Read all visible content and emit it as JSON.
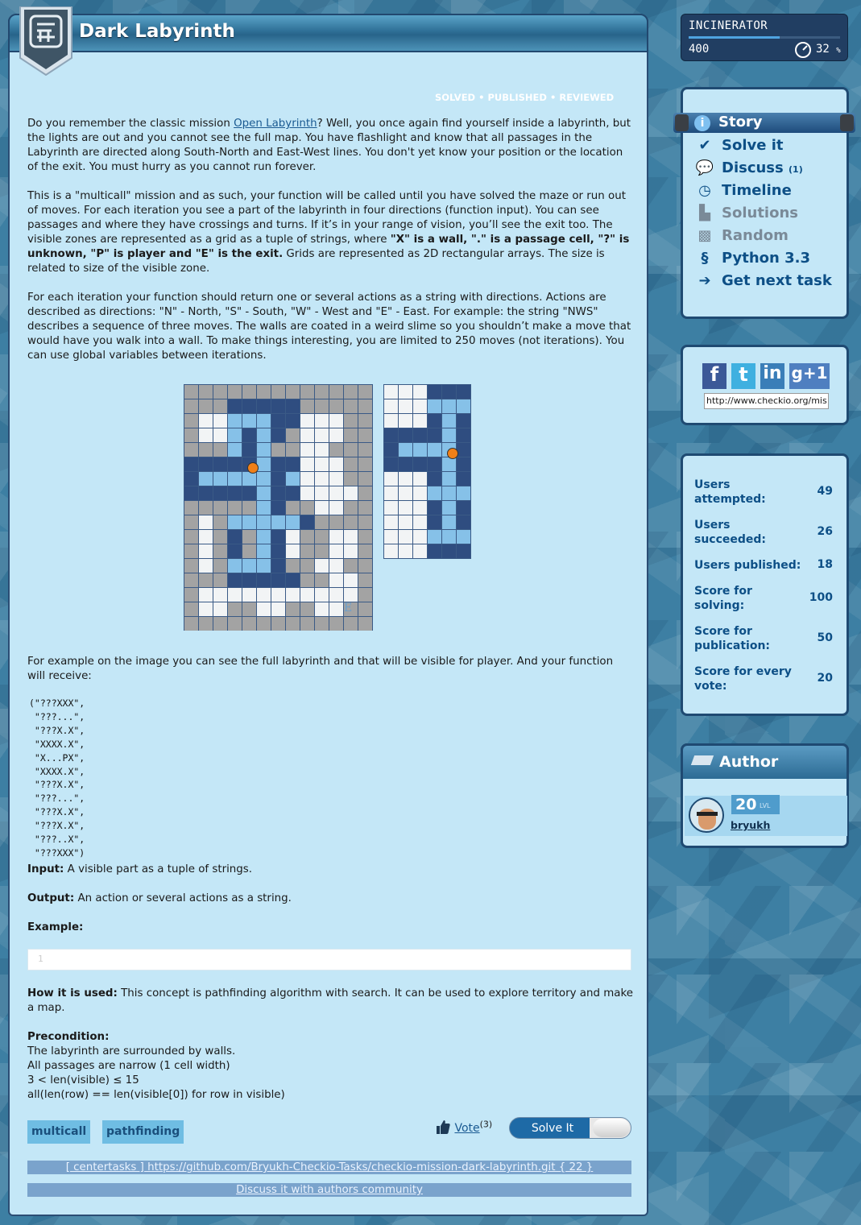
{
  "title": "Dark Labyrinth",
  "status": {
    "solved": "SOLVED",
    "published": "PUBLISHED",
    "reviewed": "REVIEWED",
    "sep": "•"
  },
  "intro": {
    "p1a": "Do you remember the classic mission ",
    "p1link": "Open Labyrinth",
    "p1b": "? Well, you once again find yourself inside a labyrinth, but the lights are out and you cannot see the full map. You have flashlight and know that all passages in the Labyrinth are directed along South-North and East-West lines. You don't yet know your position or the location of the exit. You must hurry as you cannot run forever.",
    "p2a": "This is a \"multicall\" mission and as such, your function will be called until you have solved the maze or run out of moves. For each iteration you see a part of the labyrinth in four directions (function input). You can see passages and where they have crossings and turns. If it’s in your range of vision, you’ll see the exit too. The visible zones are represented as a grid as a tuple of strings, where ",
    "p2b": "\"X\" is a wall, \".\" is a passage cell, \"?\" is unknown, \"P\" is player and \"E\" is the exit.",
    "p2c": " Grids are represented as 2D rectangular arrays. The size is related to size of the visible zone.",
    "p3": "For each iteration your function should return one or several actions as a string with directions. Actions are described as directions: \"N\" - North, \"S\" - South, \"W\" - West and \"E\" - East. For example: the string \"NWS\" describes a sequence of three moves. The walls are coated in a weird slime so you shouldn’t make a move that would have you walk into a wall. To make things interesting, you are limited to 250 moves (not iterations). You can use global variables between iterations.",
    "p4": "For example on the image you can see the full labyrinth and that will be visible for player. And your function will receive:"
  },
  "maze": {
    "exit_label": "E"
  },
  "code_example": "(\"???XXX\",\n \"???...\",\n \"???X.X\",\n \"XXXX.X\",\n \"X...PX\",\n \"XXXX.X\",\n \"???X.X\",\n \"???...\",\n \"???X.X\",\n \"???X.X\",\n \"???..X\",\n \"???XXX\")",
  "io": {
    "input_label": "Input:",
    "input_text": " A visible part as a tuple of strings.",
    "output_label": "Output:",
    "output_text": " An action or several actions as a string.",
    "example_label": "Example:",
    "code_line": "1"
  },
  "how": {
    "label": "How it is used:",
    "text": " This concept is pathfinding algorithm with search. It can be used to explore territory and make a map."
  },
  "pre": {
    "label": "Precondition:",
    "lines": [
      "The labyrinth are surrounded by walls.",
      "All passages are narrow (1 cell width)",
      "3 < len(visible) ≤ 15",
      "all(len(row) == len(visible[0]) for row in visible)"
    ]
  },
  "tags": [
    "multicall",
    "pathfinding"
  ],
  "vote": {
    "label": "Vote",
    "count": "(3)"
  },
  "solve_button": "Solve It",
  "repo_bar": "[ centertasks ] https://github.com/Bryukh-Checkio-Tasks/checkio-mission-dark-labyrinth.git { 22 }",
  "discuss_bar": "Discuss it with authors community",
  "station": {
    "name": "INCINERATOR",
    "score": "400",
    "percent": "32",
    "unit": "%",
    "progress": 0.6
  },
  "menu": [
    {
      "label": "Story",
      "icon": "info-icon",
      "active": true
    },
    {
      "label": "Solve it",
      "icon": "checkmark-icon"
    },
    {
      "label": "Discuss",
      "icon": "speech-bubble-icon",
      "count": "(1)"
    },
    {
      "label": "Timeline",
      "icon": "clock-icon"
    },
    {
      "label": "Solutions",
      "icon": "solutions-icon",
      "disabled": true
    },
    {
      "label": "Random",
      "icon": "dice-icon",
      "disabled": true
    },
    {
      "label": "Python 3.3",
      "icon": "python-icon"
    },
    {
      "label": "Get next task",
      "icon": "arrow-right-icon"
    }
  ],
  "share_url": "http://www.checkio.org/mis",
  "social": [
    "facebook-icon",
    "twitter-icon",
    "linkedin-icon",
    "google-plus-icon"
  ],
  "stats": [
    {
      "label": "Users attempted:",
      "value": "49"
    },
    {
      "label": "Users succeeded:",
      "value": "26"
    },
    {
      "label": "Users published:",
      "value": "18"
    },
    {
      "label": "Score for solving:",
      "value": "100"
    },
    {
      "label": "Score for publication:",
      "value": "50"
    },
    {
      "label": "Score for every vote:",
      "value": "20"
    }
  ],
  "author": {
    "heading": "Author",
    "level": "20",
    "level_unit": "LVL",
    "name": "bryukh"
  }
}
